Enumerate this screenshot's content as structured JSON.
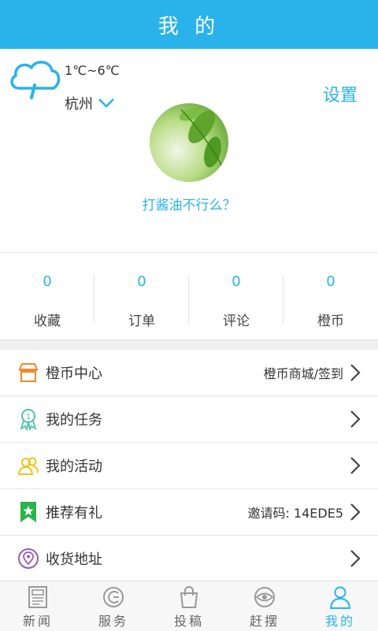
{
  "header": {
    "title": "我 的"
  },
  "weather": {
    "temp": "1℃~6℃",
    "city": "杭州"
  },
  "profile": {
    "settings_label": "设置",
    "nickname": "打酱油不行么？"
  },
  "stats": [
    {
      "value": "0",
      "label": "收藏"
    },
    {
      "value": "0",
      "label": "订单"
    },
    {
      "value": "0",
      "label": "评论"
    },
    {
      "value": "0",
      "label": "橙币"
    }
  ],
  "menu": [
    {
      "label": "橙币中心",
      "value": "橙币商城/签到",
      "icon": "shop-icon"
    },
    {
      "label": "我的任务",
      "value": "",
      "icon": "medal-icon"
    },
    {
      "label": "我的活动",
      "value": "",
      "icon": "people-icon"
    },
    {
      "label": "推荐有礼",
      "value": "邀请码: 14EDE5",
      "icon": "star-bookmark-icon"
    },
    {
      "label": "收货地址",
      "value": "",
      "icon": "location-icon"
    }
  ],
  "tabs": [
    {
      "label": "新闻",
      "icon": "newspaper-icon"
    },
    {
      "label": "服务",
      "icon": "service-icon"
    },
    {
      "label": "投稿",
      "icon": "bag-icon"
    },
    {
      "label": "赶摆",
      "icon": "eye-icon"
    },
    {
      "label": "我的",
      "icon": "user-icon"
    }
  ],
  "colors": {
    "accent": "#29b3ea",
    "menu_shop": "#f0892a",
    "menu_medal": "#4cc4a8",
    "menu_people": "#f0c419",
    "menu_star": "#2ab34a",
    "menu_location": "#9b59b6"
  }
}
